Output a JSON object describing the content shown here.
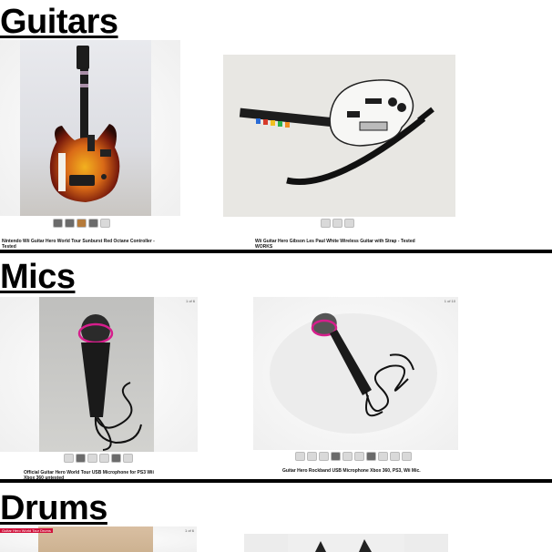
{
  "sections": {
    "guitars": {
      "title": "Guitars",
      "items": [
        {
          "caption": "Nintendo Wii Guitar Hero World Tour Sunburst Red Octane Controller - Tested",
          "thumb_count": 5
        },
        {
          "caption": "Wii Guitar Hero Gibson Les Paul White Wireless Guitar with Strap - Tested WORKS",
          "thumb_count": 3
        }
      ]
    },
    "mics": {
      "title": "Mics",
      "items": [
        {
          "caption": "Official Guitar Hero World Tour USB Microphone for PS3 Wii Xbox 360 untested",
          "corner": "1 of 6",
          "thumb_count": 6
        },
        {
          "caption": "Guitar Hero Rockband USB Microphone Xbox 360, PS3, Wii Mic.",
          "corner": "1 of 10",
          "thumb_count": 10
        }
      ]
    },
    "drums": {
      "title": "Drums",
      "items": [
        {
          "tag": "Guitar Hero World Tour Drums",
          "corner": "1 of 6"
        },
        {
          "corner": ""
        }
      ]
    }
  },
  "colors": {
    "sunburst_body": "#c4531a",
    "highlight_circle": "#d61e8c",
    "rule": "#000000"
  }
}
